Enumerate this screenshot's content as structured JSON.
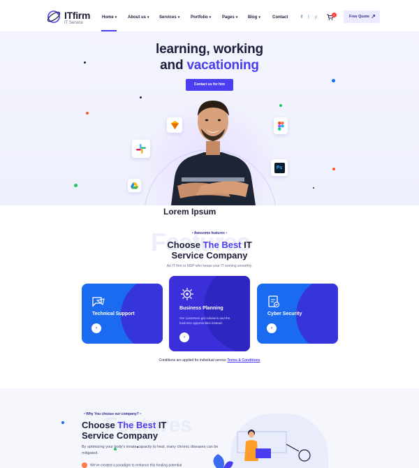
{
  "brand": {
    "name": "ITfirm",
    "tagline": "IT Service"
  },
  "nav": {
    "items": [
      {
        "label": "Home",
        "has_dropdown": true,
        "active": true
      },
      {
        "label": "About us",
        "has_dropdown": true
      },
      {
        "label": "Services",
        "has_dropdown": true
      },
      {
        "label": "Portfolio",
        "has_dropdown": true
      },
      {
        "label": "Pages",
        "has_dropdown": true
      },
      {
        "label": "Blog",
        "has_dropdown": true
      },
      {
        "label": "Contact",
        "has_dropdown": false
      }
    ],
    "social": [
      {
        "icon": "facebook-icon",
        "glyph": "f"
      },
      {
        "icon": "twitter-icon",
        "glyph": "t"
      },
      {
        "icon": "pinterest-icon",
        "glyph": "p"
      }
    ],
    "cart_count": "0",
    "quote_label": "Free Quote"
  },
  "hero": {
    "title_line1": "learning, working",
    "title_line2_prefix": "and ",
    "title_line2_accent": "vacationing",
    "button_label": "Contact us for hire",
    "app_icons": [
      "sketch-icon",
      "slack-icon",
      "google-drive-icon",
      "figma-icon",
      "photoshop-icon"
    ],
    "photoshop_text": "Ps"
  },
  "lorem": "Lorem Ipsum",
  "features": {
    "bg_word": "Features",
    "tag": "Awesome features",
    "title_prefix": "Choose ",
    "title_accent": "The Best",
    "title_suffix": " IT",
    "title_line2": "Service Company",
    "subtitle": "An IT firm or MSP who keeps your IT running smoothly.",
    "cards": [
      {
        "title": "Technical Support",
        "icon": "support-chat-icon",
        "description": ""
      },
      {
        "title": "Business Planning",
        "icon": "gear-planning-icon",
        "description": "Our customers get solutions and the business opportunities instead."
      },
      {
        "title": "Cyber Security",
        "icon": "security-document-icon",
        "description": ""
      }
    ],
    "conditions_text": "Conditions are applied for individual service ",
    "conditions_link": "Terms & Conditions"
  },
  "why": {
    "bg_word": "Features",
    "tag": "Why You choose our company?",
    "title_prefix": "Choose ",
    "title_accent": "The Best",
    "title_suffix": " IT",
    "title_line2": "Service Company",
    "description": "By optimizing your body's innate capacity to heal, many chronic diseases can be mitigated.",
    "description2": "We've created a paradigm to enhance this healing potential"
  },
  "colors": {
    "accent": "#4b3df0",
    "dark": "#1b1d3a",
    "card_blue": "#1b6bf0",
    "card_purple": "#3a2fd8"
  }
}
